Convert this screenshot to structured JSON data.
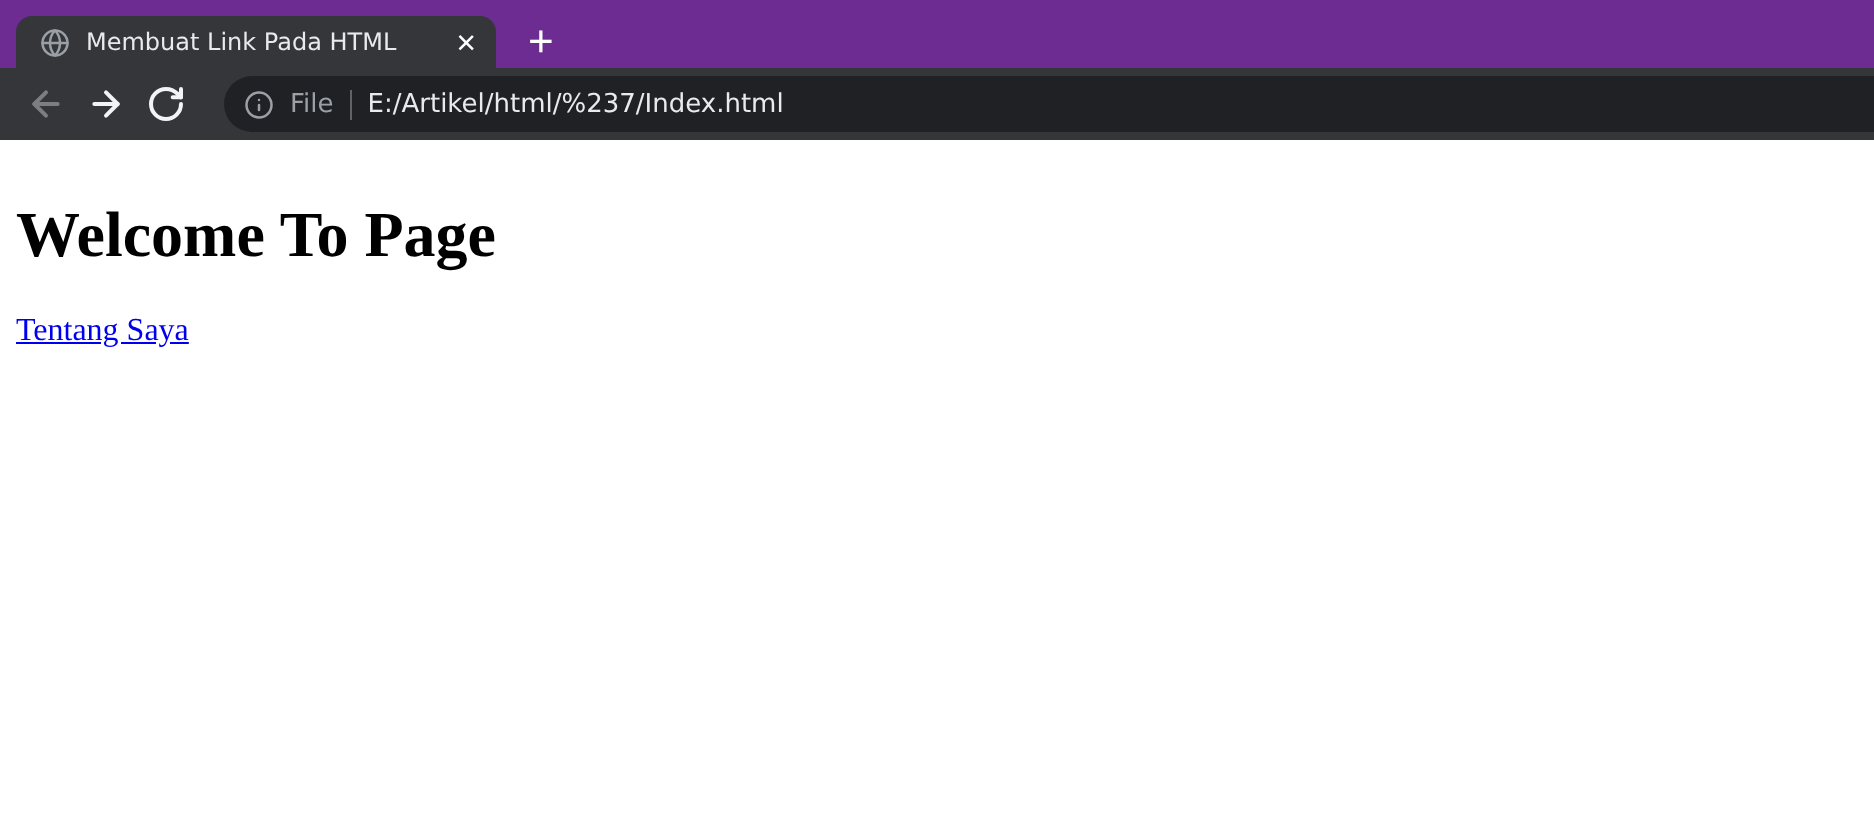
{
  "browser": {
    "tabs": [
      {
        "title": "Membuat Link Pada HTML",
        "selected": true,
        "close": "×"
      }
    ],
    "new_tab": "+",
    "nav_buttons": [
      {
        "kind": "back",
        "disabled": true
      },
      {
        "kind": "forward",
        "disabled": false
      },
      {
        "kind": "reload",
        "disabled": false
      }
    ],
    "address_bar": {
      "scheme": "File",
      "url": "E:/Artikel/html/%237/Index.html"
    }
  },
  "page": {
    "heading": "Welcome To Page",
    "link": "Tentang Saya"
  }
}
